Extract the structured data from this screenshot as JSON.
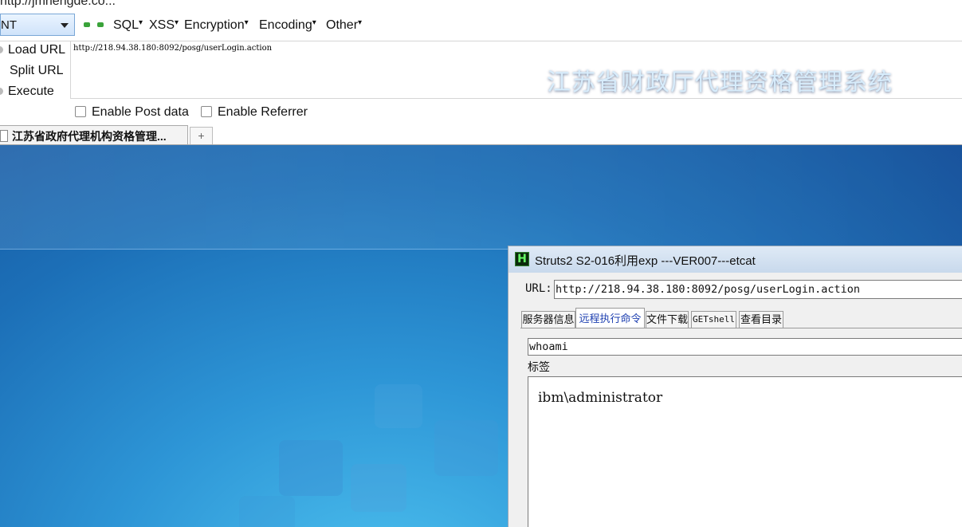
{
  "browser": {
    "top_partial_text": "http://jmnengde.co...",
    "tab_title": "江苏省政府代理机构资格管理...",
    "new_tab_symbol": "+"
  },
  "hackbar": {
    "select_value": "NT",
    "menus": [
      "SQL",
      "XSS",
      "Encryption",
      "Encoding",
      "Other"
    ],
    "menu_dropdown_marker": "▾",
    "load_url": "Load URL",
    "split_url": "Split URL",
    "execute": "Execute",
    "url_value": "http://218.94.38.180:8092/posg/userLogin.action",
    "enable_post": "Enable Post data",
    "enable_referrer": "Enable Referrer"
  },
  "page": {
    "title": "江苏省财政厅代理资格管理系统"
  },
  "tool": {
    "icon_letter": "H",
    "window_title": "Struts2 S2-016利用exp ---VER007---etcat",
    "url_label": "URL:",
    "url_value": "http://218.94.38.180:8092/posg/userLogin.action",
    "tabs": [
      "服务器信息",
      "远程执行命令",
      "文件下载",
      "GETshell",
      "查看目录"
    ],
    "active_tab_index": 1,
    "command_value": "whoami",
    "tag_label": "标签",
    "output_text": "ibm\\administrator"
  },
  "colors": {
    "page_bg_dark": "#14509a",
    "page_bg_light": "#4ec3f0",
    "page_title": "#d7ecfb",
    "active_tab_text": "#1d3fb0"
  }
}
